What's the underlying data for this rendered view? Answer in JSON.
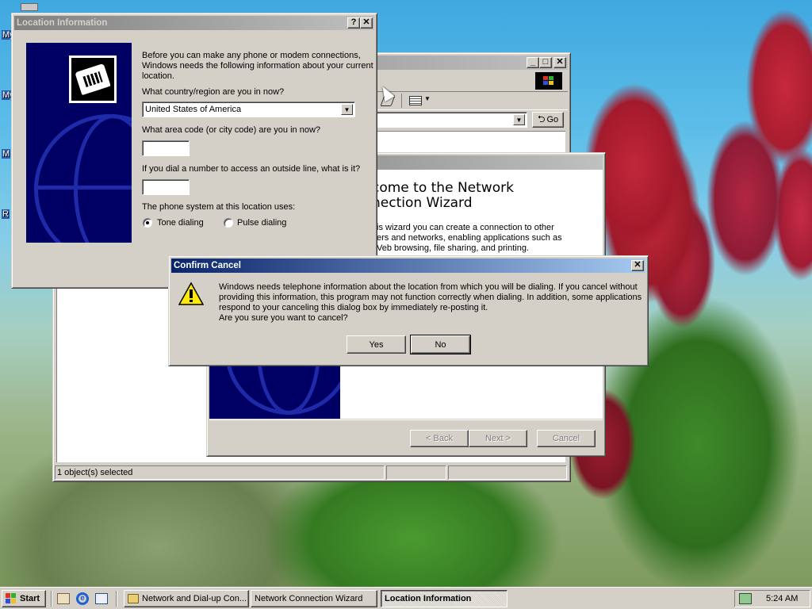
{
  "desktop": {
    "icon_labels": [
      "My",
      "My",
      "M",
      "R"
    ]
  },
  "explorer": {
    "title": "",
    "address_dropdown": "▼",
    "go_label": "Go",
    "status_left": "1 object(s) selected"
  },
  "wizard": {
    "heading_line1": "come to the Network",
    "heading_line2": "nection Wizard",
    "body_line1": "is wizard you can create a connection to other",
    "body_line2": "ers and networks, enabling applications such as",
    "body_line3": "Veb browsing, file sharing, and printing.",
    "back_label": "< Back",
    "next_label": "Next >",
    "cancel_label": "Cancel"
  },
  "location": {
    "title": "Location Information",
    "help_glyph": "?",
    "close_glyph": "✕",
    "intro_line1": "Before you can make any phone or modem connections,",
    "intro_line2": "Windows needs the following information about your current",
    "intro_line3": "location.",
    "country_label": "What country/region are you in now?",
    "country_value": "United States of America",
    "area_code_label": "What area code (or city code) are you in now?",
    "area_code_value": "",
    "outside_line_label": "If you dial a number to access an outside line, what is it?",
    "outside_line_value": "",
    "phone_system_label": "The phone system at this location uses:",
    "tone_label": "Tone dialing",
    "pulse_label": "Pulse dialing",
    "selected_dialing": "Tone dialing"
  },
  "confirm": {
    "title": "Confirm Cancel",
    "close_glyph": "✕",
    "message_line1": "Windows needs telephone information about the location from which you will be dialing. If you cancel without",
    "message_line2": "providing this information, this program may not function correctly when dialing. In addition, some applications",
    "message_line3": "respond to your canceling this dialog box by immediately re-posting it.",
    "message_line4": "Are you sure you want to cancel?",
    "yes_label": "Yes",
    "no_label": "No"
  },
  "taskbar": {
    "start_label": "Start",
    "tasks": [
      {
        "label": "Network and Dial-up Con..."
      },
      {
        "label": "Network Connection Wizard"
      },
      {
        "label": "Location Information"
      }
    ],
    "clock": "5:24 AM"
  },
  "colors": {
    "title_active": "#0a246a",
    "title_active_end": "#a6caf0",
    "title_inactive": "#808080",
    "face": "#d4d0c8",
    "wizard_panel": "#000064"
  },
  "icons": [
    "phone-icon",
    "warning-icon",
    "windows-logo-icon",
    "globe-graphic"
  ]
}
